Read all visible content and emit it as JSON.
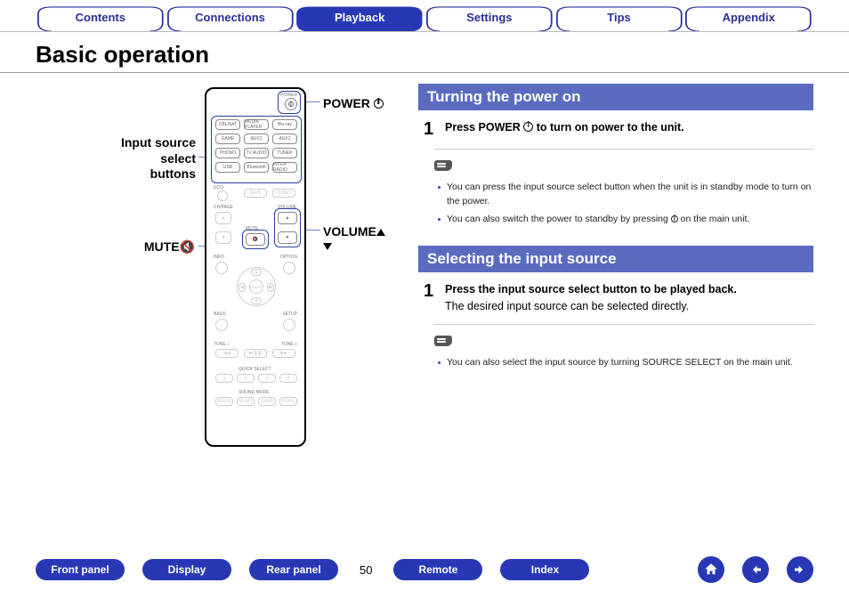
{
  "tabs": {
    "items": [
      {
        "label": "Contents",
        "active": false
      },
      {
        "label": "Connections",
        "active": false
      },
      {
        "label": "Playback",
        "active": true
      },
      {
        "label": "Settings",
        "active": false
      },
      {
        "label": "Tips",
        "active": false
      },
      {
        "label": "Appendix",
        "active": false
      }
    ]
  },
  "page_title": "Basic operation",
  "remote_callouts": {
    "power": "POWER",
    "input_source_l1": "Input source",
    "input_source_l2": "select",
    "input_source_l3": "buttons",
    "volume": "VOLUME",
    "mute": "MUTE"
  },
  "remote_labels": {
    "power_small": "POWER",
    "row1": [
      "CBL/SAT",
      "MEDIA PLAYER",
      "Blu-ray"
    ],
    "row2": [
      "GAME",
      "AUX1",
      "AUX2"
    ],
    "row3": [
      "PHONO",
      "TV AUDIO",
      "TUNER"
    ],
    "row4": [
      "USB",
      "Bluetooth",
      "INTER RADIO"
    ],
    "eco": "ECO",
    "main": "MAIN",
    "zone2": "ZONE2",
    "chpage": "CH/PAGE",
    "mute_small": "MUTE",
    "volume_small": "VOLUME",
    "info": "INFO",
    "option": "OPTION",
    "back": "BACK",
    "setup": "SETUP",
    "tune_minus": "TUNE –",
    "tune_plus": "TUNE +",
    "quick": "QUICK SELECT",
    "q1": "1",
    "q2": "2",
    "q3": "3",
    "q4": "4",
    "sound": "SOUND MODE",
    "movie": "MOVIE",
    "music": "MUSIC",
    "game2": "GAME",
    "pure": "PURE"
  },
  "sections": {
    "power": {
      "heading": "Turning the power on",
      "step_num": "1",
      "step_main_a": "Press POWER ",
      "step_main_b": " to turn on power to the unit.",
      "notes": [
        "You can press the input source select button when the unit is in standby mode to turn on the power.",
        "You can also switch the power to standby by pressing  on the main unit."
      ]
    },
    "source": {
      "heading": "Selecting the input source",
      "step_num": "1",
      "step_main": "Press the input source select button to be played back.",
      "step_sub": "The desired input source can be selected directly.",
      "notes": [
        "You can also select the input source by turning SOURCE SELECT on the main unit."
      ]
    }
  },
  "footer": {
    "buttons": [
      "Front panel",
      "Display",
      "Rear panel"
    ],
    "page": "50",
    "buttons2": [
      "Remote",
      "Index"
    ]
  },
  "colors": {
    "brand": "#2838b5",
    "section": "#5a6bc0"
  }
}
